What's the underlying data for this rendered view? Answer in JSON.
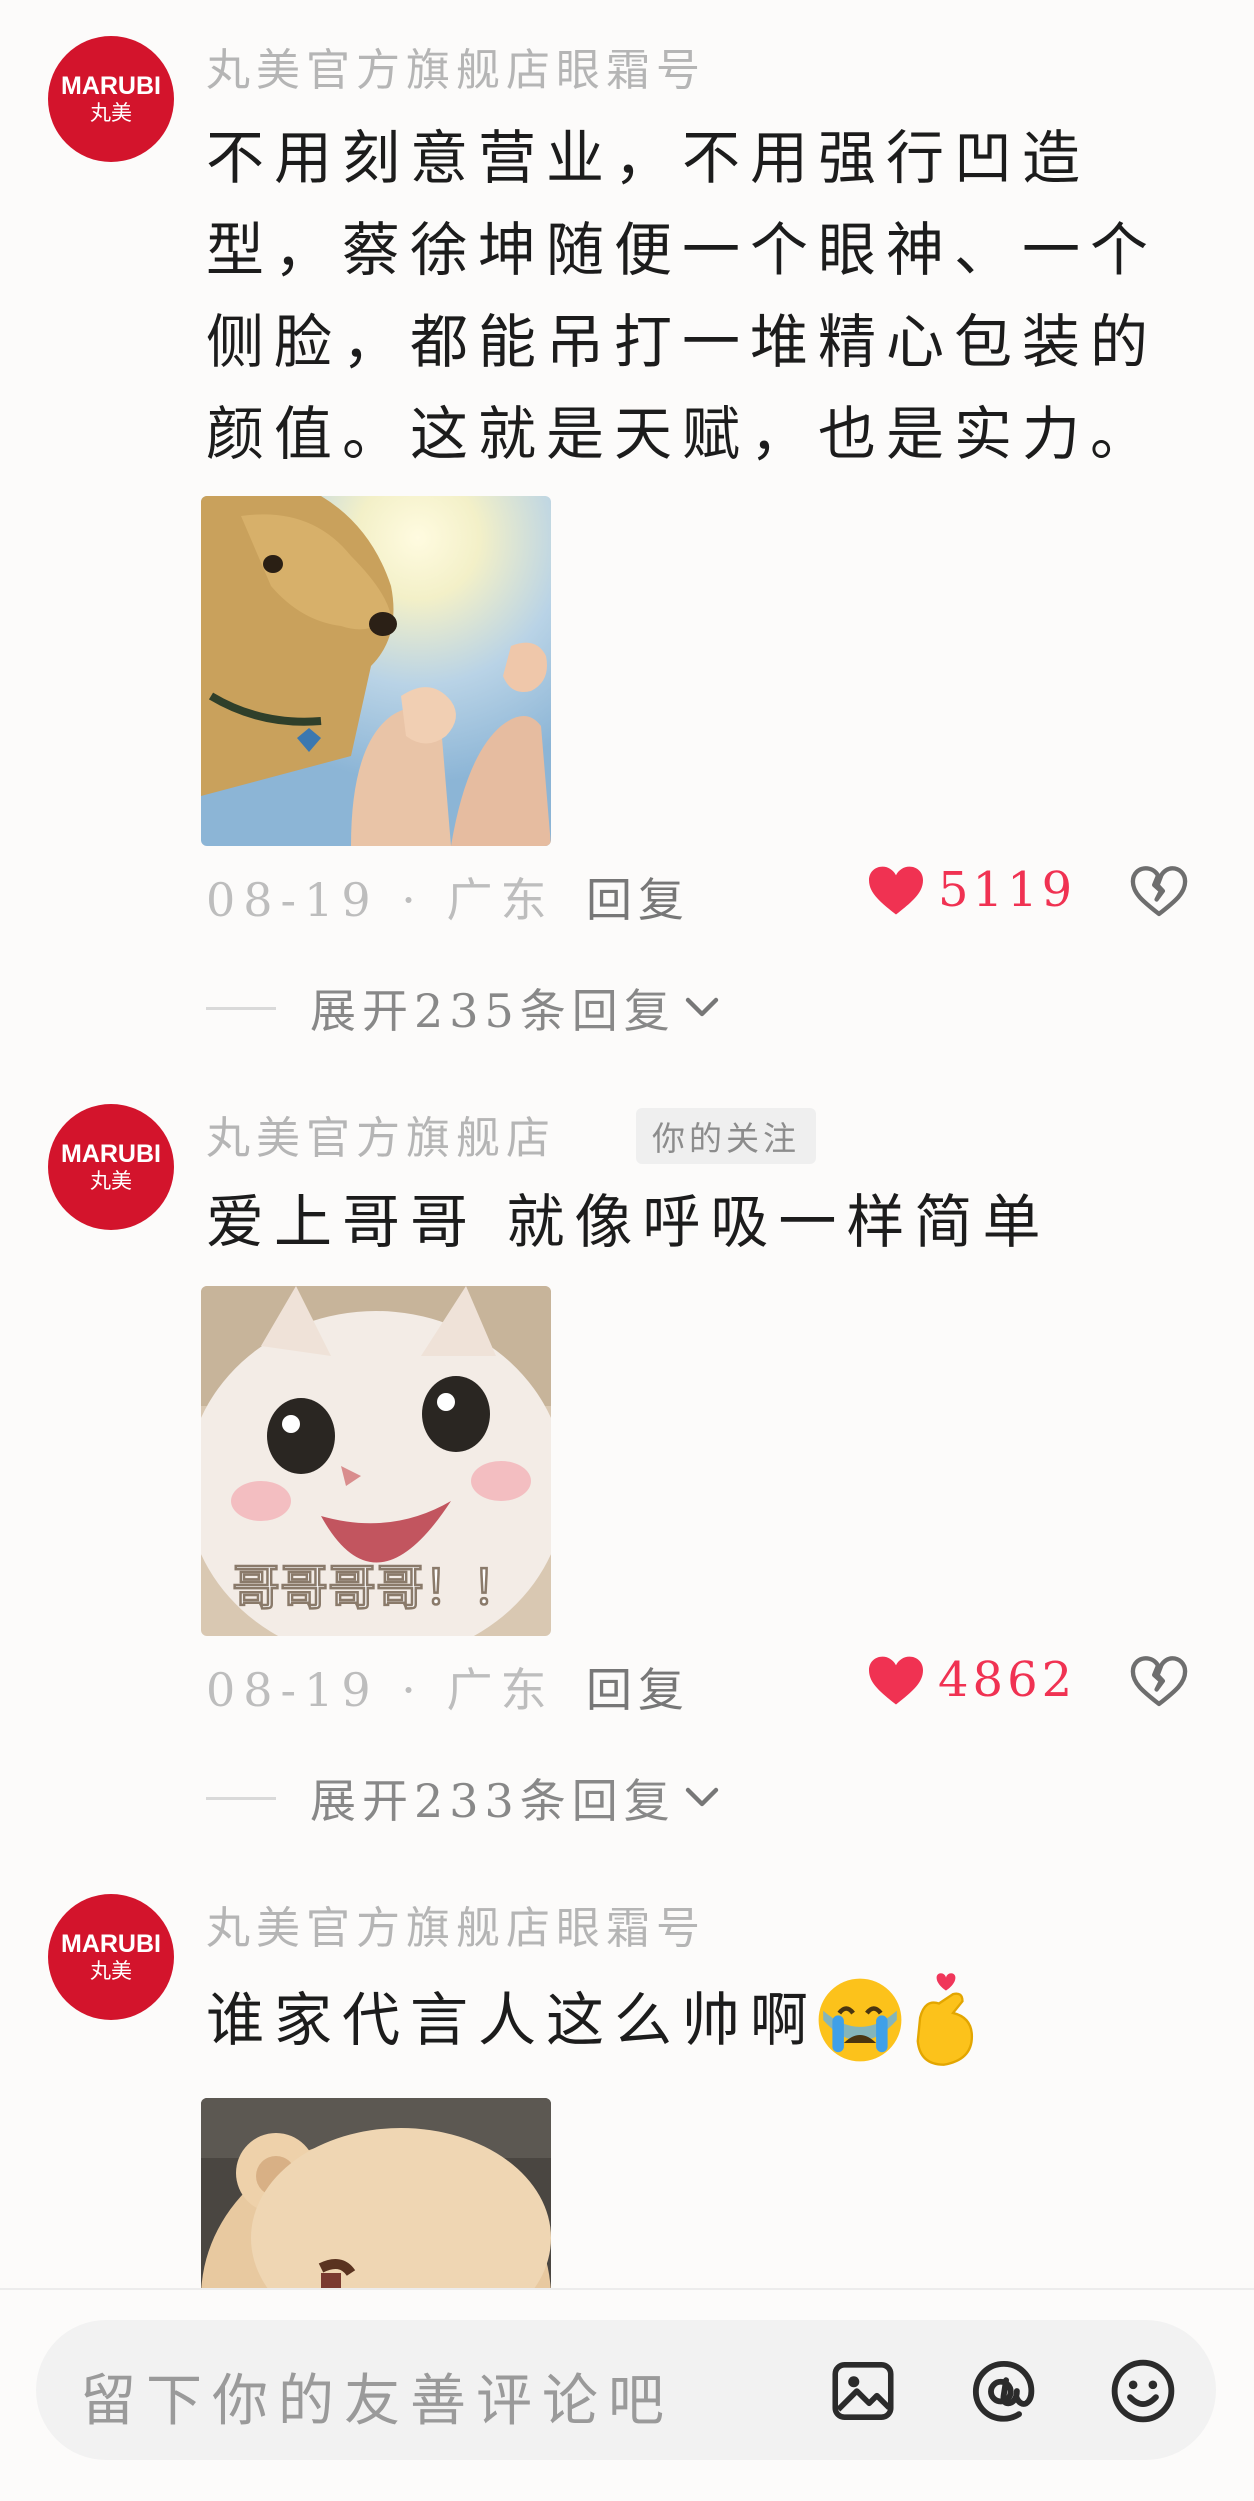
{
  "comments": [
    {
      "avatar_brand": "MARUBI",
      "avatar_brand_cn": "丸美",
      "author": "丸美官方旗舰店眼霜号",
      "text": "不用刻意营业，不用强行凹造型，蔡徐坤随便一个眼神、一个侧脸，都能吊打一堆精心包装的颜值。这就是天赋，也是实力。",
      "sticker": "dog-flexing-sticker",
      "date_location": "08-19 · 广东",
      "reply_label": "回复",
      "likes": "5119",
      "expand_label": "展开235条回复"
    },
    {
      "avatar_brand": "MARUBI",
      "avatar_brand_cn": "丸美",
      "author": "丸美官方旗舰店",
      "follow_tag": "你的关注",
      "text": "爱上哥哥 就像呼吸一样简单",
      "sticker": "kitten-sticker",
      "sticker_caption": "哥哥哥哥！！",
      "date_location": "08-19 · 广东",
      "reply_label": "回复",
      "likes": "4862",
      "expand_label": "展开233条回复"
    },
    {
      "avatar_brand": "MARUBI",
      "avatar_brand_cn": "丸美",
      "author": "丸美官方旗舰店眼霜号",
      "text": "谁家代言人这么帅啊",
      "emojis": [
        "crying-face-emoji",
        "finger-heart-emoji"
      ],
      "sticker": "bear-sticker"
    }
  ],
  "input": {
    "placeholder": "留下你的友善评论吧"
  },
  "icons": {
    "image": "image-icon",
    "mention": "at-icon",
    "emoji": "smiley-icon"
  },
  "colors": {
    "brand_red": "#d3142c",
    "like_red": "#f03252",
    "meta_gray": "#bdbdbd"
  }
}
